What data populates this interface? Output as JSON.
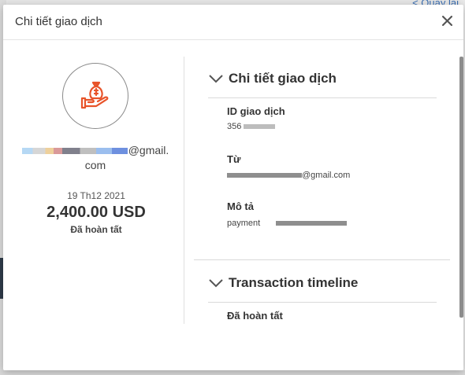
{
  "background": {
    "link_text": "< Quay lại"
  },
  "modal": {
    "title": "Chi tiết giao dịch",
    "close_label": "×"
  },
  "summary": {
    "icon": "hand-money-bag-icon",
    "email_suffix": "@gmail.",
    "email_tail": "com",
    "date": "19 Th12 2021",
    "amount": "2,400.00 USD",
    "status": "Đã hoàn tất"
  },
  "details_section": {
    "title": "Chi tiết giao dịch",
    "id_label": "ID giao dịch",
    "id_value_prefix": "356",
    "from_label": "Từ",
    "from_value_suffix": "@gmail.com",
    "description_label": "Mô tả",
    "description_value": "payment"
  },
  "timeline_section": {
    "title": "Transaction timeline",
    "first_event": "Đã hoàn tất"
  },
  "colors": {
    "accent_icon": "#e8542a",
    "text": "#333333",
    "divider": "#dadada"
  }
}
